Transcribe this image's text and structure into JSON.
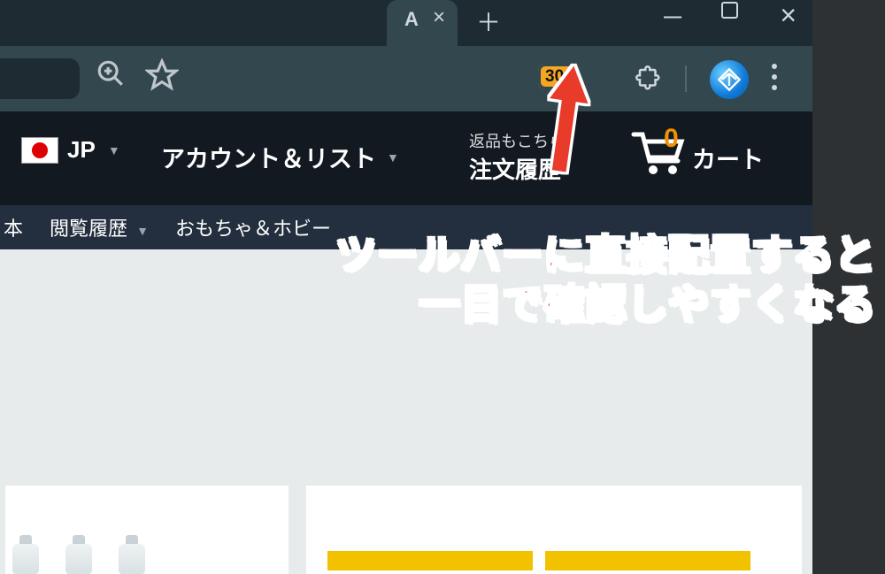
{
  "browser": {
    "tab_letter": "A",
    "badge_count": "302"
  },
  "amazon": {
    "locale_code": "JP",
    "account_list_label": "アカウント＆リスト",
    "orders_line1": "返品もこちら",
    "orders_line2": "注文履歴",
    "cart_count": "0",
    "cart_label": "カート",
    "subnav_item_1": "本",
    "subnav_item_2": "閲覧履歴",
    "subnav_item_3": "おもちゃ＆ホビー"
  },
  "annotation": {
    "line1": "ツールバーに直接配置すると",
    "line2": "一目で確認しやすくなる"
  }
}
